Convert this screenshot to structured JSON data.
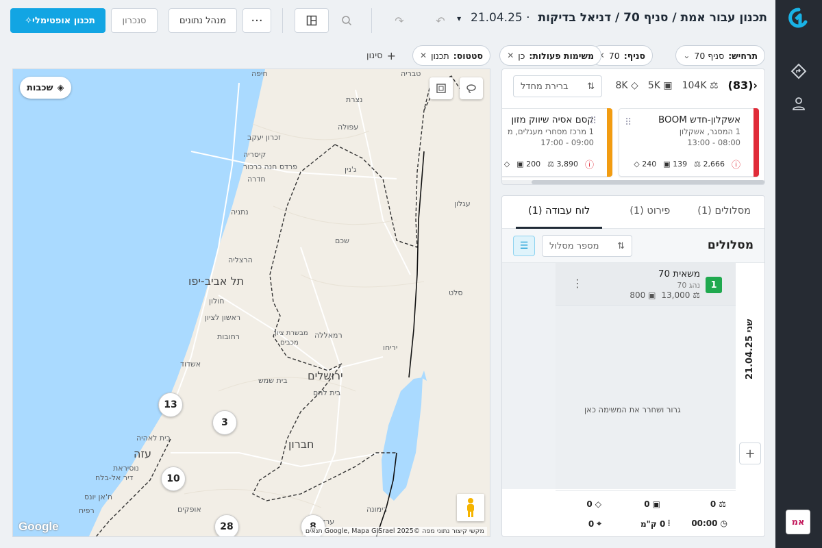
{
  "header": {
    "title": "תכנון עבור אמת / סניף 70 / דניאל בדיקות",
    "date": "21.04.25",
    "buttons": {
      "optimal": "תכנון אופטימלי",
      "sync": "סנכרון",
      "data_manager": "מנהל נתונים"
    }
  },
  "filters": [
    {
      "label": "תרחיש:",
      "value": "סניף 70",
      "type": "dropdown"
    },
    {
      "label": "סניף:",
      "value": "70",
      "type": "removable"
    },
    {
      "label": "משימות פעולות:",
      "value": "כן",
      "type": "removable"
    },
    {
      "label": "סטטוס:",
      "value": "תכנון",
      "type": "removable"
    }
  ],
  "add_filter_label": "סינון",
  "map": {
    "layers_label": "שכבות",
    "labels": [
      {
        "text": "חיפה"
      },
      {
        "text": "נצרת"
      },
      {
        "text": "עפולה"
      },
      {
        "text": "זכרון יעקב"
      },
      {
        "text": "קיסריה"
      },
      {
        "text": "פרדס חנה כרכור"
      },
      {
        "text": "חדרה"
      },
      {
        "text": "ג'נין"
      },
      {
        "text": "נתניה"
      },
      {
        "text": "שכם"
      },
      {
        "text": "הרצליה"
      },
      {
        "text": "תל אביב-יפו"
      },
      {
        "text": "חולון"
      },
      {
        "text": "ראשון לציון"
      },
      {
        "text": "רחובות"
      },
      {
        "text": "רמאללה"
      },
      {
        "text": "אשדוד"
      },
      {
        "text": "ירושלים"
      },
      {
        "text": "בית שמש"
      },
      {
        "text": "בית לחם"
      },
      {
        "text": "יריחו"
      },
      {
        "text": "חברון"
      },
      {
        "text": "עזה"
      },
      {
        "text": "רפיח"
      },
      {
        "text": "אופקים"
      },
      {
        "text": "ערד"
      },
      {
        "text": "טבריה"
      },
      {
        "text": "עגלון"
      },
      {
        "text": "סלט"
      },
      {
        "text": "מבשרת ציון"
      },
      {
        "text": "מכבים"
      },
      {
        "text": "בית לאהיה"
      },
      {
        "text": "ח'אן יונס"
      },
      {
        "text": "דיר אל-בלח"
      },
      {
        "text": "נוסיראת"
      },
      {
        "text": "דימונה"
      }
    ],
    "clusters": [
      {
        "count": "13"
      },
      {
        "count": "3"
      },
      {
        "count": "10"
      },
      {
        "count": "28"
      },
      {
        "count": "8"
      }
    ],
    "attribution": "מקשי קיצור   נתוני מפה ©2025 Google, Mapa GISrael   תנאים",
    "google": "Google"
  },
  "summary": {
    "count": "(83)",
    "weight": "104K",
    "volume": "5K",
    "pallets": "8K",
    "sort_placeholder": "ברירת מחדל"
  },
  "cards": [
    {
      "title": "אשקלון-חדש BOOM",
      "address": "1 המסגר, אשקלון",
      "hours": "08:00 - 13:00",
      "weight": "2,666",
      "volume": "139",
      "pallets": "240",
      "accent": "#e02b38"
    },
    {
      "title": "קסם אסיה שיווק מזון",
      "address": "1 מרכז מסחרי מעגלים, מ",
      "hours": "09:00 - 17:00",
      "weight": "3,890",
      "volume": "200",
      "accent": "#f29c11"
    }
  ],
  "tabs": [
    {
      "label": "מסלולים (1)"
    },
    {
      "label": "פירוט (1)"
    },
    {
      "label": "לוח עבודה (1)",
      "active": true
    }
  ],
  "routes": {
    "title": "מסלולים",
    "search_placeholder": "מספר מסלול",
    "date_label": "שני 21.04.25",
    "drop_hint": "גרור ושחרר את המשימה כאן",
    "items": [
      {
        "num": "1",
        "name": "משאית 70",
        "driver": "נהג 70",
        "weight": "13,000",
        "volume": "800",
        "color": "#20a94f"
      }
    ],
    "totals": {
      "weight": "0",
      "volume": "0",
      "pallets": "0",
      "time": "00:00",
      "distance": "0 ק\"מ",
      "stops": "0"
    }
  },
  "user": {
    "initials": "אמ"
  },
  "colors": {
    "primary": "#12a5e3",
    "rail": "#262b33",
    "route_green": "#20a94f"
  }
}
